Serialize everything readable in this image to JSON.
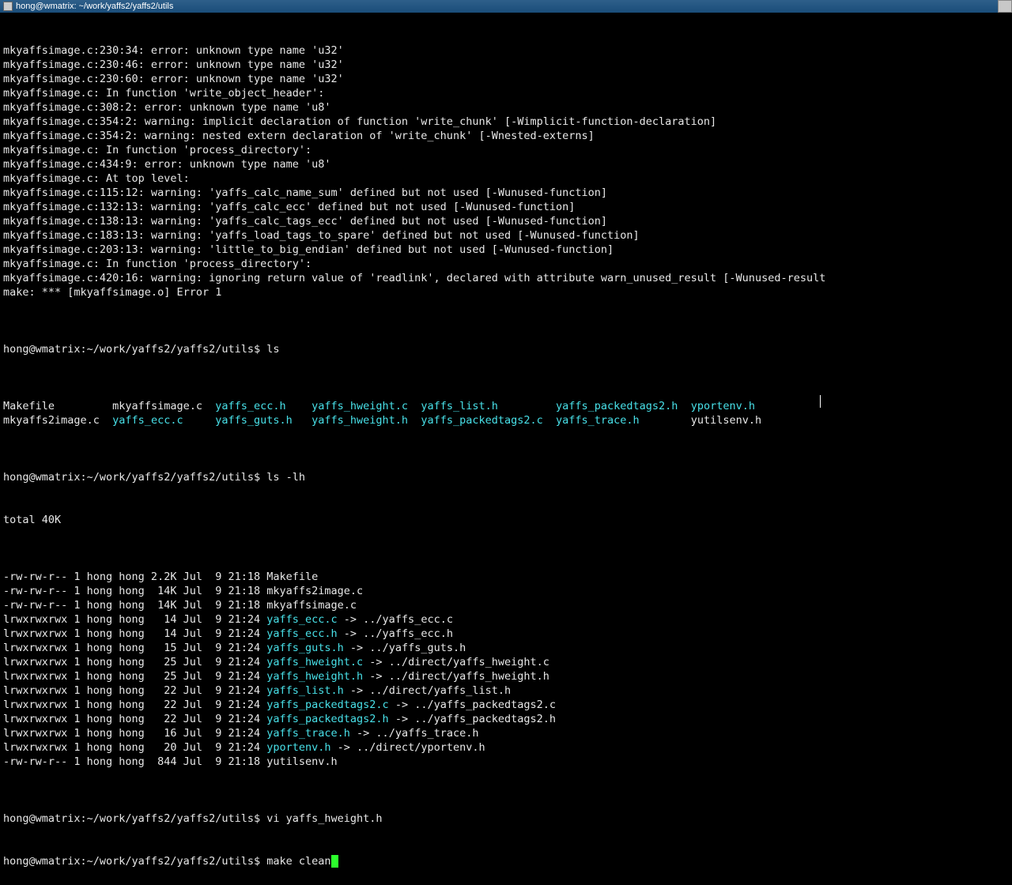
{
  "title": "hong@wmatrix: ~/work/yaffs2/yaffs2/utils",
  "compile": [
    "mkyaffsimage.c:230:34: error: unknown type name 'u32'",
    "mkyaffsimage.c:230:46: error: unknown type name 'u32'",
    "mkyaffsimage.c:230:60: error: unknown type name 'u32'",
    "mkyaffsimage.c: In function 'write_object_header':",
    "mkyaffsimage.c:308:2: error: unknown type name 'u8'",
    "mkyaffsimage.c:354:2: warning: implicit declaration of function 'write_chunk' [-Wimplicit-function-declaration]",
    "mkyaffsimage.c:354:2: warning: nested extern declaration of 'write_chunk' [-Wnested-externs]",
    "mkyaffsimage.c: In function 'process_directory':",
    "mkyaffsimage.c:434:9: error: unknown type name 'u8'",
    "mkyaffsimage.c: At top level:",
    "mkyaffsimage.c:115:12: warning: 'yaffs_calc_name_sum' defined but not used [-Wunused-function]",
    "mkyaffsimage.c:132:13: warning: 'yaffs_calc_ecc' defined but not used [-Wunused-function]",
    "mkyaffsimage.c:138:13: warning: 'yaffs_calc_tags_ecc' defined but not used [-Wunused-function]",
    "mkyaffsimage.c:183:13: warning: 'yaffs_load_tags_to_spare' defined but not used [-Wunused-function]",
    "mkyaffsimage.c:203:13: warning: 'little_to_big_endian' defined but not used [-Wunused-function]",
    "mkyaffsimage.c: In function 'process_directory':",
    "mkyaffsimage.c:420:16: warning: ignoring return value of 'readlink', declared with attribute warn_unused_result [-Wunused-result",
    "make: *** [mkyaffsimage.o] Error 1"
  ],
  "prompt1": "hong@wmatrix:~/work/yaffs2/yaffs2/utils$ ",
  "cmd_ls": "ls",
  "ls_row1": "Makefile         mkyaffsimage.c  yaffs_ecc.h    yaffs_hweight.c  yaffs_list.h         yaffs_packedtags2.h  yportenv.h",
  "ls_row2": "mkyaffs2image.c  yaffs_ecc.c     yaffs_guts.h   yaffs_hweight.h  yaffs_packedtags2.c  yaffs_trace.h        yutilsenv.h",
  "ls_names1": [
    "Makefile",
    "mkyaffsimage.c",
    "yaffs_ecc.h",
    "yaffs_hweight.c",
    "yaffs_list.h",
    "yaffs_packedtags2.h",
    "yportenv.h"
  ],
  "ls_names2": [
    "mkyaffs2image.c",
    "yaffs_ecc.c",
    "yaffs_guts.h",
    "yaffs_hweight.h",
    "yaffs_packedtags2.c",
    "yaffs_trace.h",
    "yutilsenv.h"
  ],
  "cmd_lslh": "ls -lh",
  "total": "total 40K",
  "files": [
    {
      "perm": "-rw-rw-r-- 1 hong hong 2.2K Jul  9 21:18 ",
      "name": "Makefile",
      "link": "",
      "sym": false
    },
    {
      "perm": "-rw-rw-r-- 1 hong hong  14K Jul  9 21:18 ",
      "name": "mkyaffs2image.c",
      "link": "",
      "sym": false
    },
    {
      "perm": "-rw-rw-r-- 1 hong hong  14K Jul  9 21:18 ",
      "name": "mkyaffsimage.c",
      "link": "",
      "sym": false
    },
    {
      "perm": "lrwxrwxrwx 1 hong hong   14 Jul  9 21:24 ",
      "name": "yaffs_ecc.c",
      "link": " -> ../yaffs_ecc.c",
      "sym": true
    },
    {
      "perm": "lrwxrwxrwx 1 hong hong   14 Jul  9 21:24 ",
      "name": "yaffs_ecc.h",
      "link": " -> ../yaffs_ecc.h",
      "sym": true
    },
    {
      "perm": "lrwxrwxrwx 1 hong hong   15 Jul  9 21:24 ",
      "name": "yaffs_guts.h",
      "link": " -> ../yaffs_guts.h",
      "sym": true
    },
    {
      "perm": "lrwxrwxrwx 1 hong hong   25 Jul  9 21:24 ",
      "name": "yaffs_hweight.c",
      "link": " -> ../direct/yaffs_hweight.c",
      "sym": true
    },
    {
      "perm": "lrwxrwxrwx 1 hong hong   25 Jul  9 21:24 ",
      "name": "yaffs_hweight.h",
      "link": " -> ../direct/yaffs_hweight.h",
      "sym": true
    },
    {
      "perm": "lrwxrwxrwx 1 hong hong   22 Jul  9 21:24 ",
      "name": "yaffs_list.h",
      "link": " -> ../direct/yaffs_list.h",
      "sym": true
    },
    {
      "perm": "lrwxrwxrwx 1 hong hong   22 Jul  9 21:24 ",
      "name": "yaffs_packedtags2.c",
      "link": " -> ../yaffs_packedtags2.c",
      "sym": true
    },
    {
      "perm": "lrwxrwxrwx 1 hong hong   22 Jul  9 21:24 ",
      "name": "yaffs_packedtags2.h",
      "link": " -> ../yaffs_packedtags2.h",
      "sym": true
    },
    {
      "perm": "lrwxrwxrwx 1 hong hong   16 Jul  9 21:24 ",
      "name": "yaffs_trace.h",
      "link": " -> ../yaffs_trace.h",
      "sym": true
    },
    {
      "perm": "lrwxrwxrwx 1 hong hong   20 Jul  9 21:24 ",
      "name": "yportenv.h",
      "link": " -> ../direct/yportenv.h",
      "sym": true
    },
    {
      "perm": "-rw-rw-r-- 1 hong hong  844 Jul  9 21:18 ",
      "name": "yutilsenv.h",
      "link": "",
      "sym": false
    }
  ],
  "cmd_vi": "vi yaffs_hweight.h",
  "cmd_make": "make clean"
}
